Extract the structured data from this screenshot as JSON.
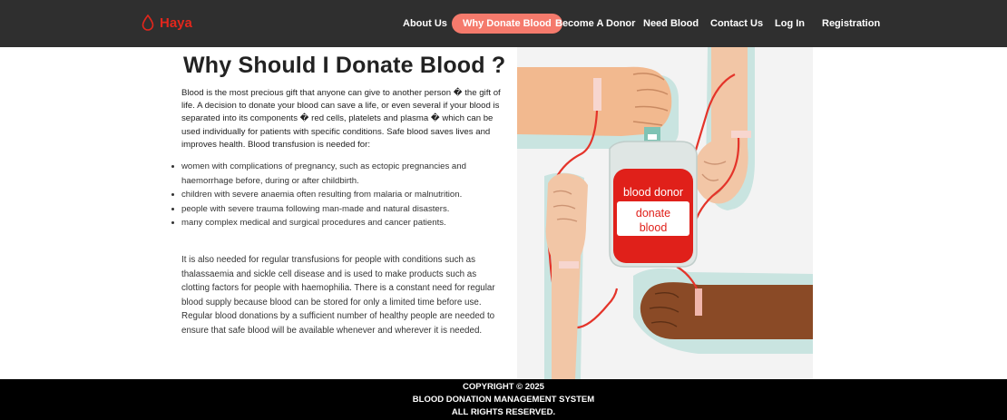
{
  "brand": {
    "name": "Haya",
    "icon": "blood-drop-icon",
    "color": "#e2261c"
  },
  "nav": {
    "items": [
      {
        "label": "About Us",
        "active": false
      },
      {
        "label": "Why Donate Blood",
        "active": true
      },
      {
        "label": "Become A Donor",
        "active": false
      },
      {
        "label": "Need Blood",
        "active": false
      },
      {
        "label": "Contact Us",
        "active": false
      },
      {
        "label": "Log In",
        "active": false
      },
      {
        "label": "Registration",
        "active": false
      }
    ],
    "active_color": "#f57a6c",
    "bar_color": "#2f2f2f"
  },
  "main": {
    "title": "Why Should I Donate Blood ?",
    "intro": "Blood is the most precious gift that anyone can give to another person � the gift of life. A decision to donate your blood can save a life, or even several if your blood is separated into its components � red cells, platelets and plasma � which can be used individually for patients with specific conditions. Safe blood saves lives and improves health. Blood transfusion is needed for:",
    "uses": [
      "women with complications of pregnancy, such as ectopic pregnancies and haemorrhage before, during or after childbirth.",
      "children with severe anaemia often resulting from malaria or malnutrition.",
      "people with severe trauma following man-made and natural disasters.",
      "many complex medical and surgical procedures and cancer patients."
    ],
    "outro": "It is also needed for regular transfusions for people with conditions such as thalassaemia and sickle cell disease and is used to make products such as clotting factors for people with haemophilia. There is a constant need for regular blood supply because blood can be stored for only a limited time before use. Regular blood donations by a sufficient number of healthy people are needed to ensure that safe blood will be available whenever and wherever it is needed."
  },
  "illustration": {
    "bag_label_top": "blood donor",
    "bag_label_mid": "donate",
    "bag_label_bottom": "blood"
  },
  "footer": {
    "line1": "COPYRIGHT © 2025",
    "line2": "BLOOD DONATION MANAGEMENT SYSTEM",
    "line3": "ALL RIGHTS RESERVED."
  }
}
